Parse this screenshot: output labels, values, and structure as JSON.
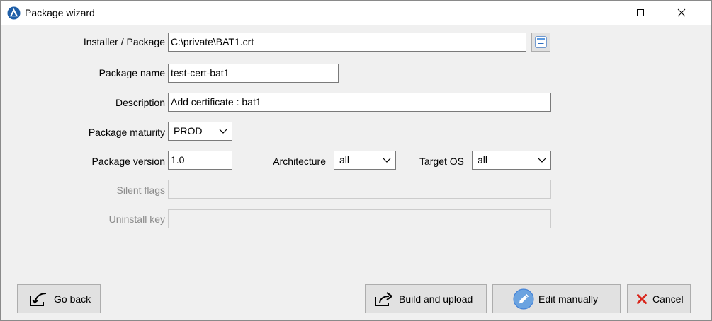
{
  "window": {
    "title": "Package wizard"
  },
  "form": {
    "installer": {
      "label": "Installer / Package",
      "value": "C:\\private\\BAT1.crt"
    },
    "package_name": {
      "label": "Package name",
      "value": "test-cert-bat1"
    },
    "description": {
      "label": "Description",
      "value": "Add certificate : bat1"
    },
    "maturity": {
      "label": "Package maturity",
      "value": "PROD"
    },
    "version": {
      "label": "Package version",
      "value": "1.0"
    },
    "architecture": {
      "label": "Architecture",
      "value": "all"
    },
    "target_os": {
      "label": "Target OS",
      "value": "all"
    },
    "silent_flags": {
      "label": "Silent flags",
      "value": ""
    },
    "uninstall_key": {
      "label": "Uninstall key",
      "value": ""
    }
  },
  "buttons": {
    "go_back": "Go back",
    "build_upload": "Build and upload",
    "edit_manually": "Edit manually",
    "cancel": "Cancel"
  },
  "icons": {
    "app": "tranquil-it-logo-icon",
    "browse": "browse-file-icon",
    "go_back": "go-back-icon",
    "build_upload": "share-upload-icon",
    "edit_manually": "pencil-icon",
    "cancel": "cancel-x-icon"
  },
  "colors": {
    "accent_blue": "#3a7bd5",
    "cancel_red": "#d9261c"
  }
}
